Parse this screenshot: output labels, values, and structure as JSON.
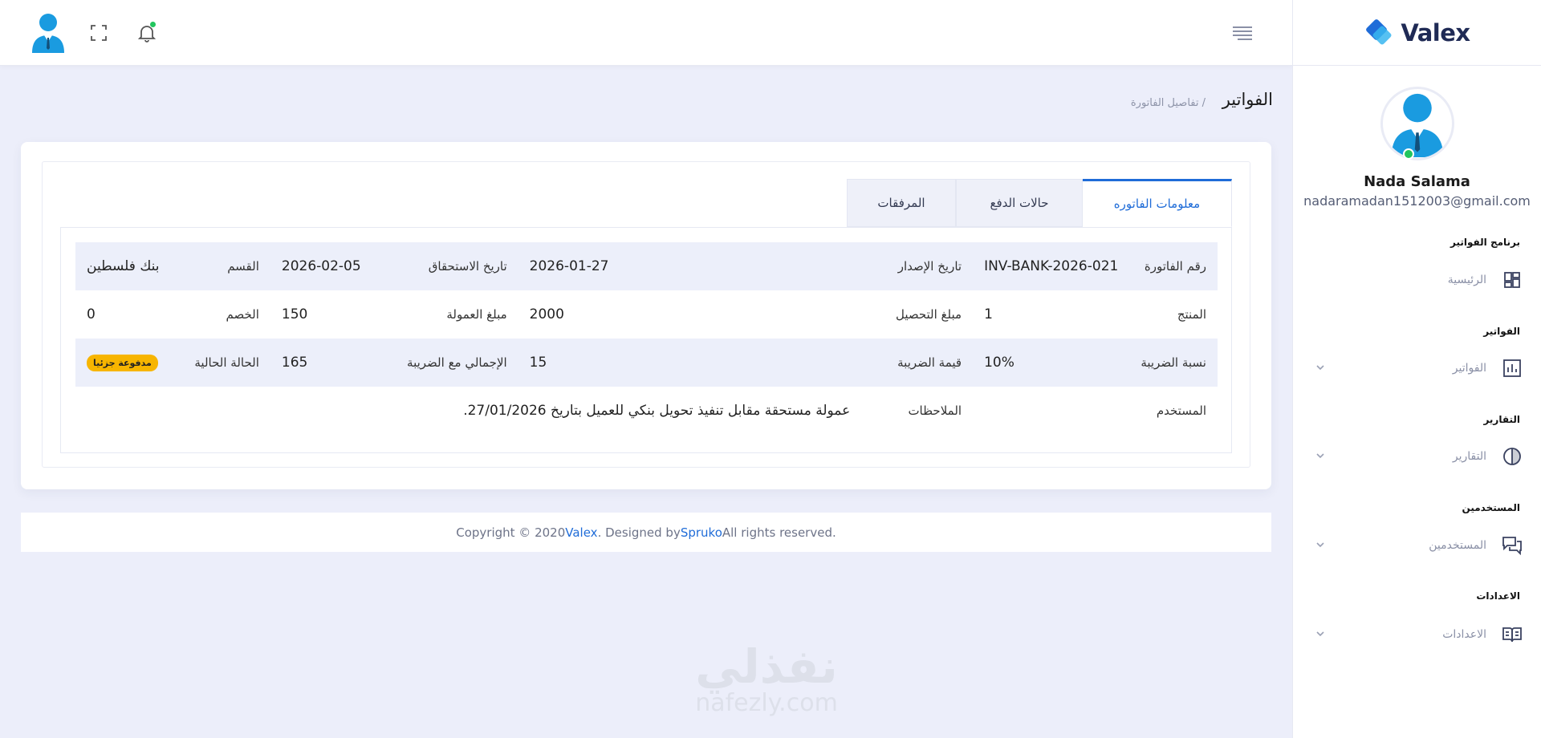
{
  "header": {
    "avatar_icon": "user-avatar-icon",
    "fullscreen_icon": "fullscreen-icon",
    "notification_icon": "bell-icon",
    "menu_icon": "hamburger-menu-icon"
  },
  "sidebar": {
    "brand": "Valex",
    "user": {
      "name": "Nada Salama",
      "email": "nadaramadan1512003@gmail.com"
    },
    "sections": [
      {
        "title": "برنامج الفواتير",
        "item": "الرئيسية",
        "icon": "dashboard-icon",
        "has_chevron": false
      },
      {
        "title": "الفواتير",
        "item": "الفواتير",
        "icon": "bar-chart-icon",
        "has_chevron": true
      },
      {
        "title": "التقارير",
        "item": "التقارير",
        "icon": "pie-chart-icon",
        "has_chevron": true
      },
      {
        "title": "المستخدمين",
        "item": "المستخدمين",
        "icon": "chat-icon",
        "has_chevron": true
      },
      {
        "title": "الاعدادات",
        "item": "الاعدادات",
        "icon": "book-icon",
        "has_chevron": true
      }
    ]
  },
  "page": {
    "title": "الفواتير",
    "breadcrumb": "/ تفاصيل الفاتورة"
  },
  "tabs": [
    "معلومات الفاتوره",
    "حالات الدفع",
    "المرفقات"
  ],
  "active_tab": "معلومات الفاتوره",
  "invoice": {
    "rows": [
      [
        {
          "label": "رقم الفاتورة",
          "value": "INV-BANK-2026-021"
        },
        {
          "label": "تاريخ الإصدار",
          "value": "2026-01-27"
        },
        {
          "label": "تاريخ الاستحقاق",
          "value": "2026-02-05"
        },
        {
          "label": "القسم",
          "value": "بنك فلسطين"
        }
      ],
      [
        {
          "label": "المنتج",
          "value": "1"
        },
        {
          "label": "مبلغ التحصيل",
          "value": "2000"
        },
        {
          "label": "مبلغ العمولة",
          "value": "150"
        },
        {
          "label": "الخصم",
          "value": "0"
        }
      ],
      [
        {
          "label": "نسبة الضريبة",
          "value": "10%"
        },
        {
          "label": "قيمة الضريبة",
          "value": "15"
        },
        {
          "label": "الإجمالي مع الضريبة",
          "value": "165"
        },
        {
          "label": "الحالة الحالية",
          "value": "مدفوعة جزئيا"
        }
      ]
    ],
    "user_label": "المستخدم",
    "notes_label": "الملاحظات",
    "notes_value": "عمولة مستحقة مقابل تنفيذ تحويل بنكي للعميل بتاريخ 27/01/2026.",
    "status_color": "#f7b500"
  },
  "footer": {
    "prefix": "Copyright © 2020 ",
    "brand": "Valex",
    "middle": ". Designed by ",
    "designer": "Spruko",
    "suffix": " All rights reserved."
  },
  "watermark": {
    "ar": "نفذلي",
    "en": "nafezly.com"
  },
  "colors": {
    "accent": "#1f6cd8",
    "online": "#22c55e",
    "background": "#eceefa"
  }
}
